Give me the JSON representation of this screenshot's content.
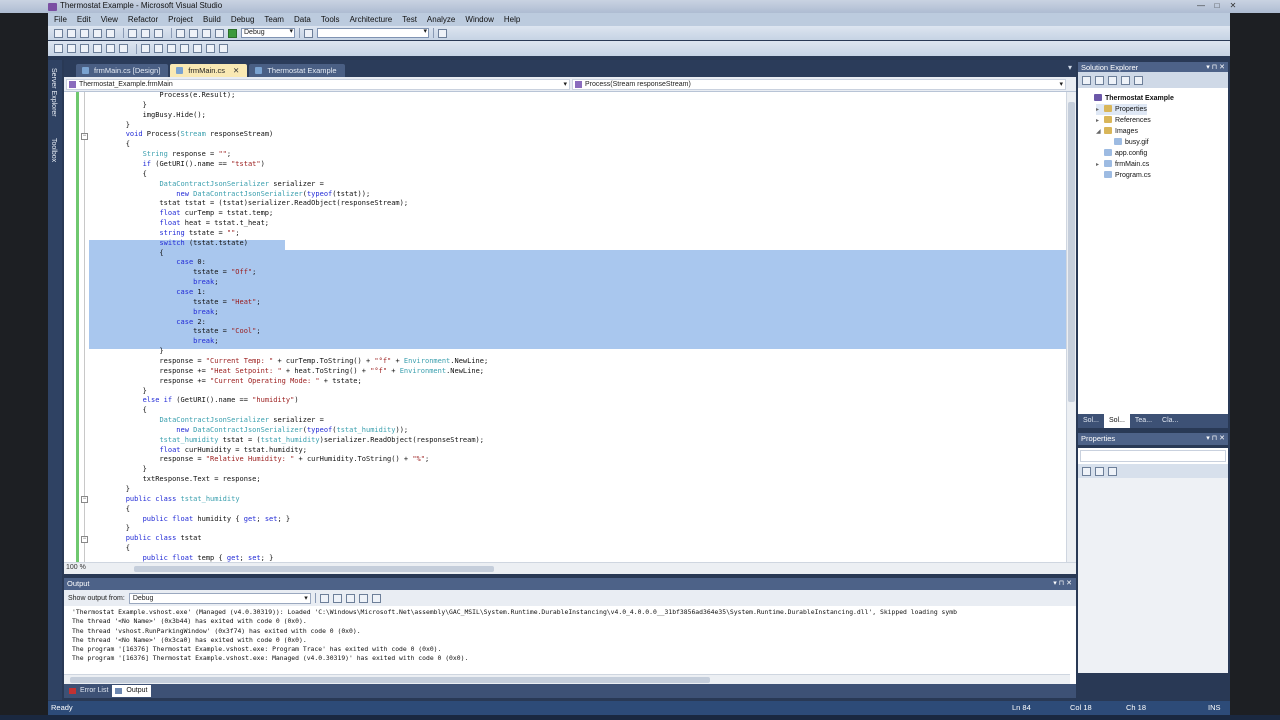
{
  "window": {
    "title": "Thermostat Example - Microsoft Visual Studio"
  },
  "menu": [
    "File",
    "Edit",
    "View",
    "Refactor",
    "Project",
    "Build",
    "Debug",
    "Team",
    "Data",
    "Tools",
    "Architecture",
    "Test",
    "Analyze",
    "Window",
    "Help"
  ],
  "toolbar": {
    "config": "Debug"
  },
  "left_strip": {
    "server_explorer": "Server Explorer",
    "toolbox": "Toolbox"
  },
  "tabs": [
    {
      "label": "frmMain.cs [Design]",
      "active": false
    },
    {
      "label": "frmMain.cs",
      "active": true
    },
    {
      "label": "Thermostat Example",
      "active": false
    }
  ],
  "nav": {
    "class_dropdown": "Thermostat_Example.frmMain",
    "member_dropdown": "Process(Stream responseStream)"
  },
  "code_lines": [
    "                Process(e.Result);",
    "            }",
    "            imgBusy.Hide();",
    "        }",
    "        void Process(Stream responseStream)",
    "        {",
    "            String response = \"\";",
    "            if (GetURI().name == \"tstat\")",
    "            {",
    "                DataContractJsonSerializer serializer =",
    "                    new DataContractJsonSerializer(typeof(tstat));",
    "                tstat tstat = (tstat)serializer.ReadObject(responseStream);",
    "                float curTemp = tstat.temp;",
    "                float heat = tstat.t_heat;",
    "                string tstate = \"\";",
    "                switch (tstat.tstate)",
    "                {",
    "                    case 0:",
    "                        tstate = \"Off\";",
    "                        break;",
    "                    case 1:",
    "                        tstate = \"Heat\";",
    "                        break;",
    "                    case 2:",
    "                        tstate = \"Cool\";",
    "                        break;",
    "                }",
    "                response = \"Current Temp: \" + curTemp.ToString() + \"°f\" + Environment.NewLine;",
    "                response += \"Heat Setpoint: \" + heat.ToString() + \"°f\" + Environment.NewLine;",
    "                response += \"Current Operating Mode: \" + tstate;",
    "            }",
    "            else if (GetURI().name == \"humidity\")",
    "            {",
    "                DataContractJsonSerializer serializer =",
    "                    new DataContractJsonSerializer(typeof(tstat_humidity));",
    "                tstat_humidity tstat = (tstat_humidity)serializer.ReadObject(responseStream);",
    "                float curHumidity = tstat.humidity;",
    "                response = \"Relative Humidity: \" + curHumidity.ToString() + \"%\";",
    "            }",
    "            txtResponse.Text = response;",
    "        }",
    "        public class tstat_humidity",
    "        {",
    "            public float humidity { get; set; }",
    "        }",
    "        public class tstat",
    "        {",
    "            public float temp { get; set; }"
  ],
  "editor": {
    "zoom": "100 %"
  },
  "solution_explorer": {
    "title": "Solution Explorer",
    "items": [
      {
        "label": "Thermostat Example",
        "level": 0,
        "icon": "project-icon",
        "arrow": ""
      },
      {
        "label": "Properties",
        "level": 1,
        "icon": "folder-icon",
        "arrow": "▸"
      },
      {
        "label": "References",
        "level": 1,
        "icon": "folder-icon",
        "arrow": "▸"
      },
      {
        "label": "Images",
        "level": 1,
        "icon": "folder-icon",
        "arrow": "◢"
      },
      {
        "label": "busy.gif",
        "level": 2,
        "icon": "file-icon",
        "arrow": ""
      },
      {
        "label": "app.config",
        "level": 1,
        "icon": "file-icon",
        "arrow": ""
      },
      {
        "label": "frmMain.cs",
        "level": 1,
        "icon": "cs-file-icon",
        "arrow": "▸"
      },
      {
        "label": "Program.cs",
        "level": 1,
        "icon": "cs-file-icon",
        "arrow": ""
      }
    ],
    "tabs": [
      "Sol...",
      "Sol...",
      "Tea...",
      "Cla..."
    ]
  },
  "properties": {
    "title": "Properties"
  },
  "output": {
    "title": "Output",
    "show_from_label": "Show output from:",
    "show_from_value": "Debug",
    "lines": [
      "'Thermostat Example.vshost.exe' (Managed (v4.0.30319)): Loaded 'C:\\Windows\\Microsoft.Net\\assembly\\GAC_MSIL\\System.Runtime.DurableInstancing\\v4.0_4.0.0.0__31bf3856ad364e35\\System.Runtime.DurableInstancing.dll', Skipped loading symb",
      "The thread '<No Name>' (0x3b44) has exited with code 0 (0x0).",
      "The thread 'vshost.RunParkingWindow' (0x3f74) has exited with code 0 (0x0).",
      "The thread '<No Name>' (0x3ca0) has exited with code 0 (0x0).",
      "The program '[16376] Thermostat Example.vshost.exe: Program Trace' has exited with code 0 (0x0).",
      "The program '[16376] Thermostat Example.vshost.exe: Managed (v4.0.30319)' has exited with code 0 (0x0)."
    ],
    "tabs": [
      "Error List",
      "Output"
    ]
  },
  "status": {
    "ready": "Ready",
    "line": "Ln 84",
    "col": "Col 18",
    "ch": "Ch 18",
    "mode": "INS"
  },
  "colors": {
    "keyword": "#2029d6",
    "type": "#3a9fae",
    "string": "#9a1b1b",
    "selection": "#a9c7ee",
    "panel_header": "#4d6288"
  }
}
